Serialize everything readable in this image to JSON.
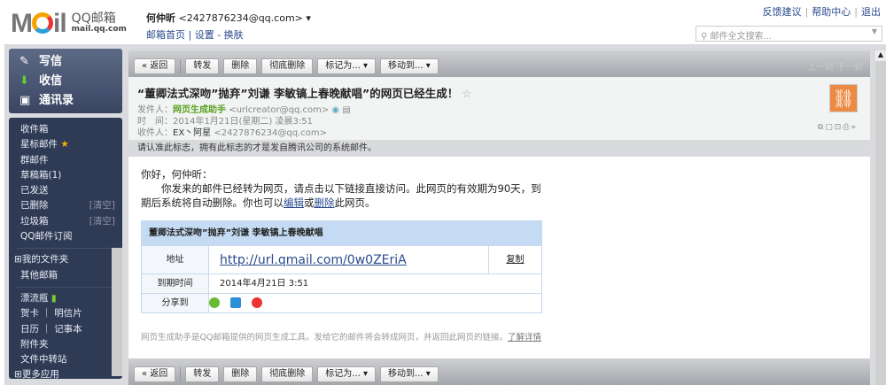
{
  "header": {
    "logo_text": "MOIL",
    "brand": "QQ邮箱",
    "domain": "mail.qq.com",
    "user_name": "何仲昕",
    "user_email": "<2427876234@qq.com>",
    "links": [
      "邮箱首页",
      "设置",
      "换肤"
    ],
    "top_links": [
      "反馈建议",
      "帮助中心",
      "退出"
    ],
    "search_placeholder": "邮件全文搜索..."
  },
  "sidebar": {
    "primary": [
      "写信",
      "收信",
      "通讯录"
    ],
    "folders": [
      "收件箱",
      "星标邮件",
      "群邮件",
      "草稿箱(1)",
      "已发送",
      "已删除",
      "垃圾箱",
      "QQ邮件订阅"
    ],
    "clear_label": "[清空]",
    "my_folders": "我的文件夹",
    "other": "其他邮箱",
    "apps": [
      "漂流瓶",
      "贺卡",
      "明信片",
      "日历",
      "记事本",
      "附件夹",
      "文件中转站"
    ],
    "more": "更多应用"
  },
  "toolbar": {
    "back": "« 返回",
    "forward": "转发",
    "delete": "删除",
    "perm_delete": "彻底删除",
    "mark": "标记为... ▾",
    "move": "移动到... ▾",
    "prev": "上一封",
    "next": "下一封"
  },
  "mail": {
    "subject": "“董卿法式深吻”抛弃”刘谦 李敏镐上春晚献唱”的网页已经生成！",
    "from_label": "发件人：",
    "from_name": "网页生成助手",
    "from_email": "<urlcreator@qq.com>",
    "time_label": "时　间：",
    "time": "2014年1月21日(星期二) 凌晨3:51",
    "to_label": "收件人：",
    "to_name": "EX丶阿星",
    "to_email": "<2427876234@qq.com>",
    "notice": "请认准此标志，拥有此标志的才是发自腾讯公司的系统邮件。",
    "greeting": "你好，何仲昕：",
    "para1": "你发来的邮件已经转为网页，请点击以下链接直接访问。此网页的有效期为90天，到期后系统将自动删除。你也可以",
    "edit": "编辑",
    "or": "或",
    "del": "删除",
    "para_end": "此网页。",
    "table": {
      "title": "董卿法式深吻”抛弃”刘谦 李敏镐上春晚献唱",
      "addr_label": "地址",
      "url": "http://url.qmail.com/0w0ZEriA",
      "copy": "复制",
      "expire_label": "到期时间",
      "expire": "2014年4月21日 3:51",
      "share_label": "分享到"
    },
    "footer": "网页生成助手是QQ邮箱提供的网页生成工具。发给它的邮件将会转成网页，并返回此网页的链接。",
    "footer_link": "了解详情"
  }
}
